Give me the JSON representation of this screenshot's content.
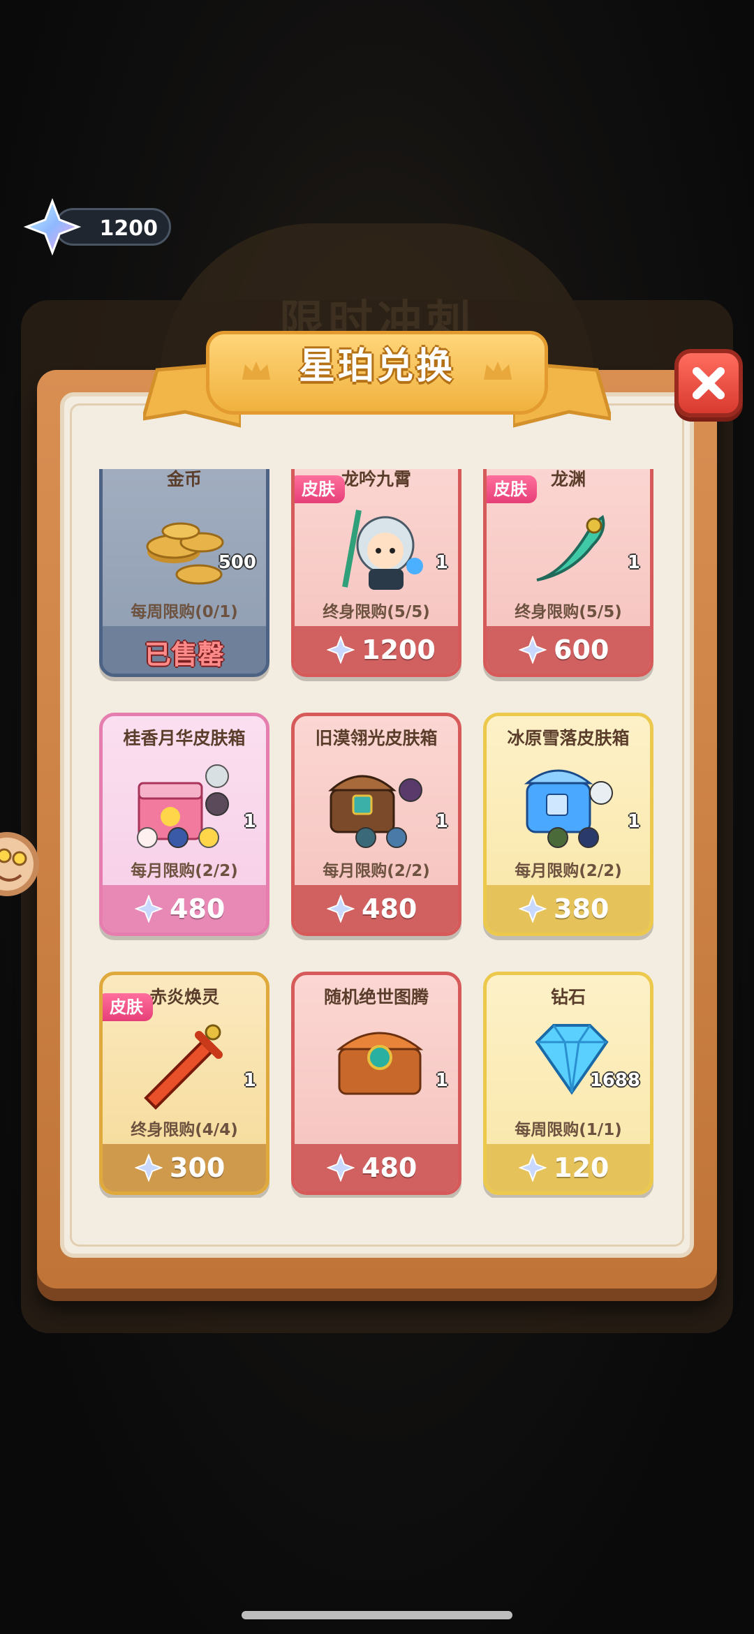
{
  "currency": {
    "amount": "1200",
    "icon": "star-crystal-icon"
  },
  "background": {
    "title": "限时冲刺"
  },
  "panel": {
    "title": "星珀兑换"
  },
  "cards": [
    {
      "name": "金币",
      "qty": "500",
      "limit": "每周限购(0/1)",
      "status": "已售罄",
      "theme": "blue",
      "icon": "gold-coins-icon"
    },
    {
      "name": "龙吟九霄",
      "qty": "1",
      "limit": "终身限购(5/5)",
      "price": "1200",
      "tag": "皮肤",
      "theme": "red",
      "icon": "dragon-warrior-icon"
    },
    {
      "name": "龙渊",
      "qty": "1",
      "limit": "终身限购(5/5)",
      "price": "600",
      "tag": "皮肤",
      "theme": "red",
      "icon": "jade-blade-icon"
    },
    {
      "name": "桂香月华皮肤箱",
      "qty": "1",
      "limit": "每月限购(2/2)",
      "price": "480",
      "theme": "pink",
      "icon": "mystery-box-icon"
    },
    {
      "name": "旧漠翎光皮肤箱",
      "qty": "1",
      "limit": "每月限购(2/2)",
      "price": "480",
      "theme": "red",
      "icon": "treasure-chest-icon"
    },
    {
      "name": "冰原雪落皮肤箱",
      "qty": "1",
      "limit": "每月限购(2/2)",
      "price": "380",
      "theme": "yellow",
      "icon": "ice-chest-icon"
    },
    {
      "name": "赤炎焕灵",
      "qty": "1",
      "limit": "终身限购(4/4)",
      "price": "300",
      "tag": "皮肤",
      "theme": "gold",
      "icon": "fire-sword-icon"
    },
    {
      "name": "随机绝世图腾",
      "qty": "1",
      "limit": "",
      "price": "480",
      "theme": "red",
      "icon": "totem-chest-icon"
    },
    {
      "name": "钻石",
      "qty": "1688",
      "limit": "每周限购(1/1)",
      "price": "120",
      "theme": "yellow",
      "icon": "diamond-icon"
    }
  ]
}
